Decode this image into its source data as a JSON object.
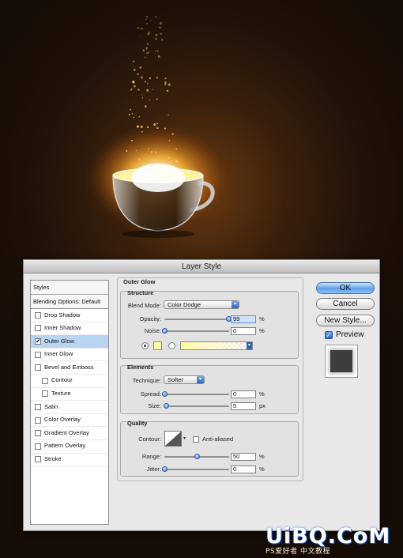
{
  "dialog": {
    "title": "Layer Style"
  },
  "styles_panel": {
    "header": "Styles",
    "blending": "Blending Options: Default",
    "items": [
      {
        "label": "Drop Shadow",
        "checked": false,
        "indent": false
      },
      {
        "label": "Inner Shadow",
        "checked": false,
        "indent": false
      },
      {
        "label": "Outer Glow",
        "checked": true,
        "indent": false,
        "selected": true
      },
      {
        "label": "Inner Glow",
        "checked": false,
        "indent": false
      },
      {
        "label": "Bevel and Emboss",
        "checked": false,
        "indent": false
      },
      {
        "label": "Contour",
        "checked": false,
        "indent": true
      },
      {
        "label": "Texture",
        "checked": false,
        "indent": true
      },
      {
        "label": "Satin",
        "checked": false,
        "indent": false
      },
      {
        "label": "Color Overlay",
        "checked": false,
        "indent": false
      },
      {
        "label": "Gradient Overlay",
        "checked": false,
        "indent": false
      },
      {
        "label": "Pattern Overlay",
        "checked": false,
        "indent": false
      },
      {
        "label": "Stroke",
        "checked": false,
        "indent": false
      }
    ]
  },
  "outer_glow": {
    "title": "Outer Glow",
    "structure": {
      "title": "Structure",
      "blend_mode_label": "Blend Mode:",
      "blend_mode": "Color Dodge",
      "opacity_label": "Opacity:",
      "opacity": "99",
      "opacity_level": 0.99,
      "noise_label": "Noise:",
      "noise": "0",
      "noise_level": 0,
      "percent": "%",
      "glow_color": "#ffffa8"
    },
    "elements": {
      "title": "Elements",
      "technique_label": "Technique:",
      "technique": "Softer",
      "spread_label": "Spread:",
      "spread": "0",
      "spread_level": 0,
      "size_label": "Size:",
      "size": "5",
      "size_level": 0.02,
      "percent": "%",
      "px": "px"
    },
    "quality": {
      "title": "Quality",
      "contour_label": "Contour:",
      "anti_aliased_label": "Anti-aliased",
      "anti_aliased": false,
      "range_label": "Range:",
      "range": "50",
      "range_level": 0.5,
      "jitter_label": "Jitter:",
      "jitter": "0",
      "jitter_level": 0,
      "percent": "%"
    }
  },
  "buttons": {
    "ok": "OK",
    "cancel": "Cancel",
    "new_style": "New Style...",
    "preview_label": "Preview",
    "preview_checked": true
  },
  "watermark": {
    "main": "UiBQ.CoM",
    "sub": "PS爱好者 中文教程"
  },
  "colors": {
    "accent": "#3c7ad6",
    "selected_row": "#b9d4f3",
    "glow": "#ffcc55"
  }
}
